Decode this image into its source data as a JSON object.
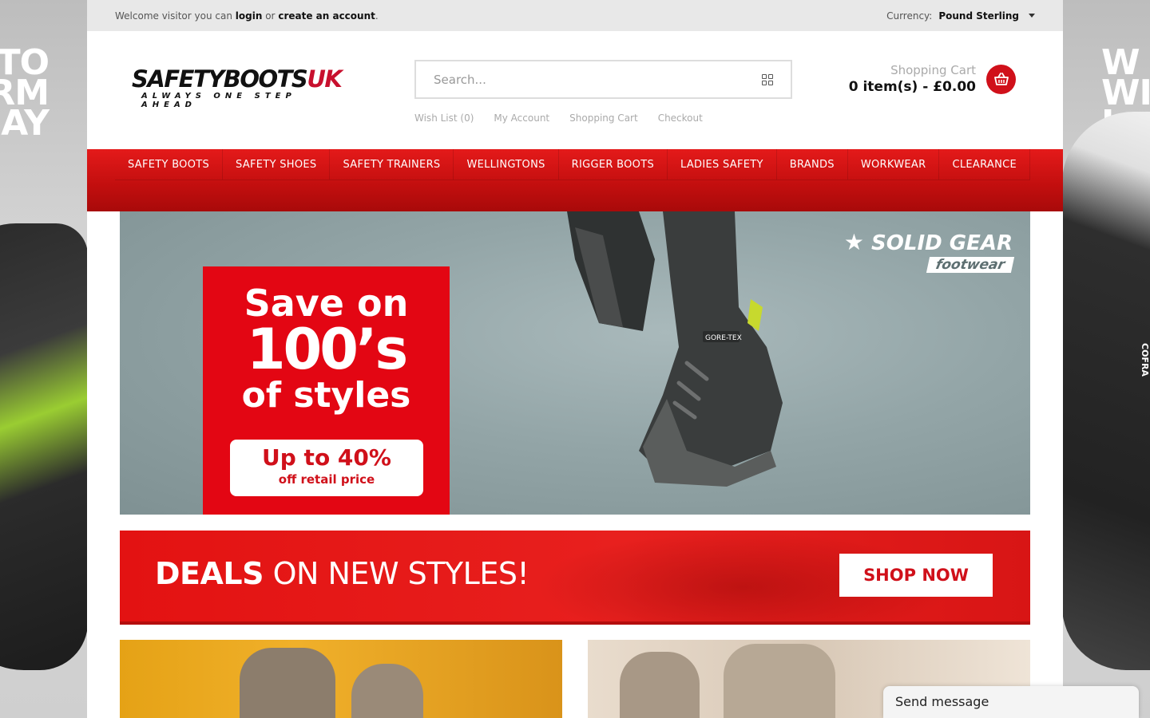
{
  "side_banner": {
    "left_lines": [
      "TO",
      "RM",
      "AY"
    ],
    "right_lines": [
      "W",
      "WI",
      "L"
    ],
    "right_brand": "COFRA"
  },
  "topbar": {
    "welcome_prefix": "Welcome visitor you can",
    "login": "login",
    "or": "or",
    "create_account": "create an account",
    "period": ".",
    "currency_label": "Currency:",
    "currency_value": "Pound Sterling"
  },
  "header": {
    "logo_main": "SAFETYBOOTS",
    "logo_uk": "UK",
    "logo_tagline": "ALWAYS ONE STEP AHEAD",
    "search_placeholder": "Search...",
    "links": [
      "Wish List (0)",
      "My Account",
      "Shopping Cart",
      "Checkout"
    ],
    "cart_label": "Shopping Cart",
    "cart_total": "0 item(s) - £0.00"
  },
  "nav": {
    "items": [
      "SAFETY BOOTS",
      "SAFETY SHOES",
      "SAFETY TRAINERS",
      "WELLINGTONS",
      "RIGGER BOOTS",
      "LADIES SAFETY",
      "BRANDS",
      "WORKWEAR",
      "CLEARANCE"
    ]
  },
  "hero": {
    "line1": "Save on",
    "line2": "100’s",
    "line3": "of styles",
    "pill_line1": "Up to 40%",
    "pill_line2": "off retail price",
    "brand_line1": "SOLID GEAR",
    "brand_line2": "footwear",
    "boot_text": "GORE-TEX"
  },
  "deals": {
    "bold_text": "DEALS",
    "rest_text": "ON NEW STYLES!",
    "button": "SHOP NOW"
  },
  "chat": {
    "label": "Send message"
  },
  "colors": {
    "brand_red": "#e30613",
    "nav_red": "#c10e0e",
    "cart_red": "#d0101a"
  }
}
